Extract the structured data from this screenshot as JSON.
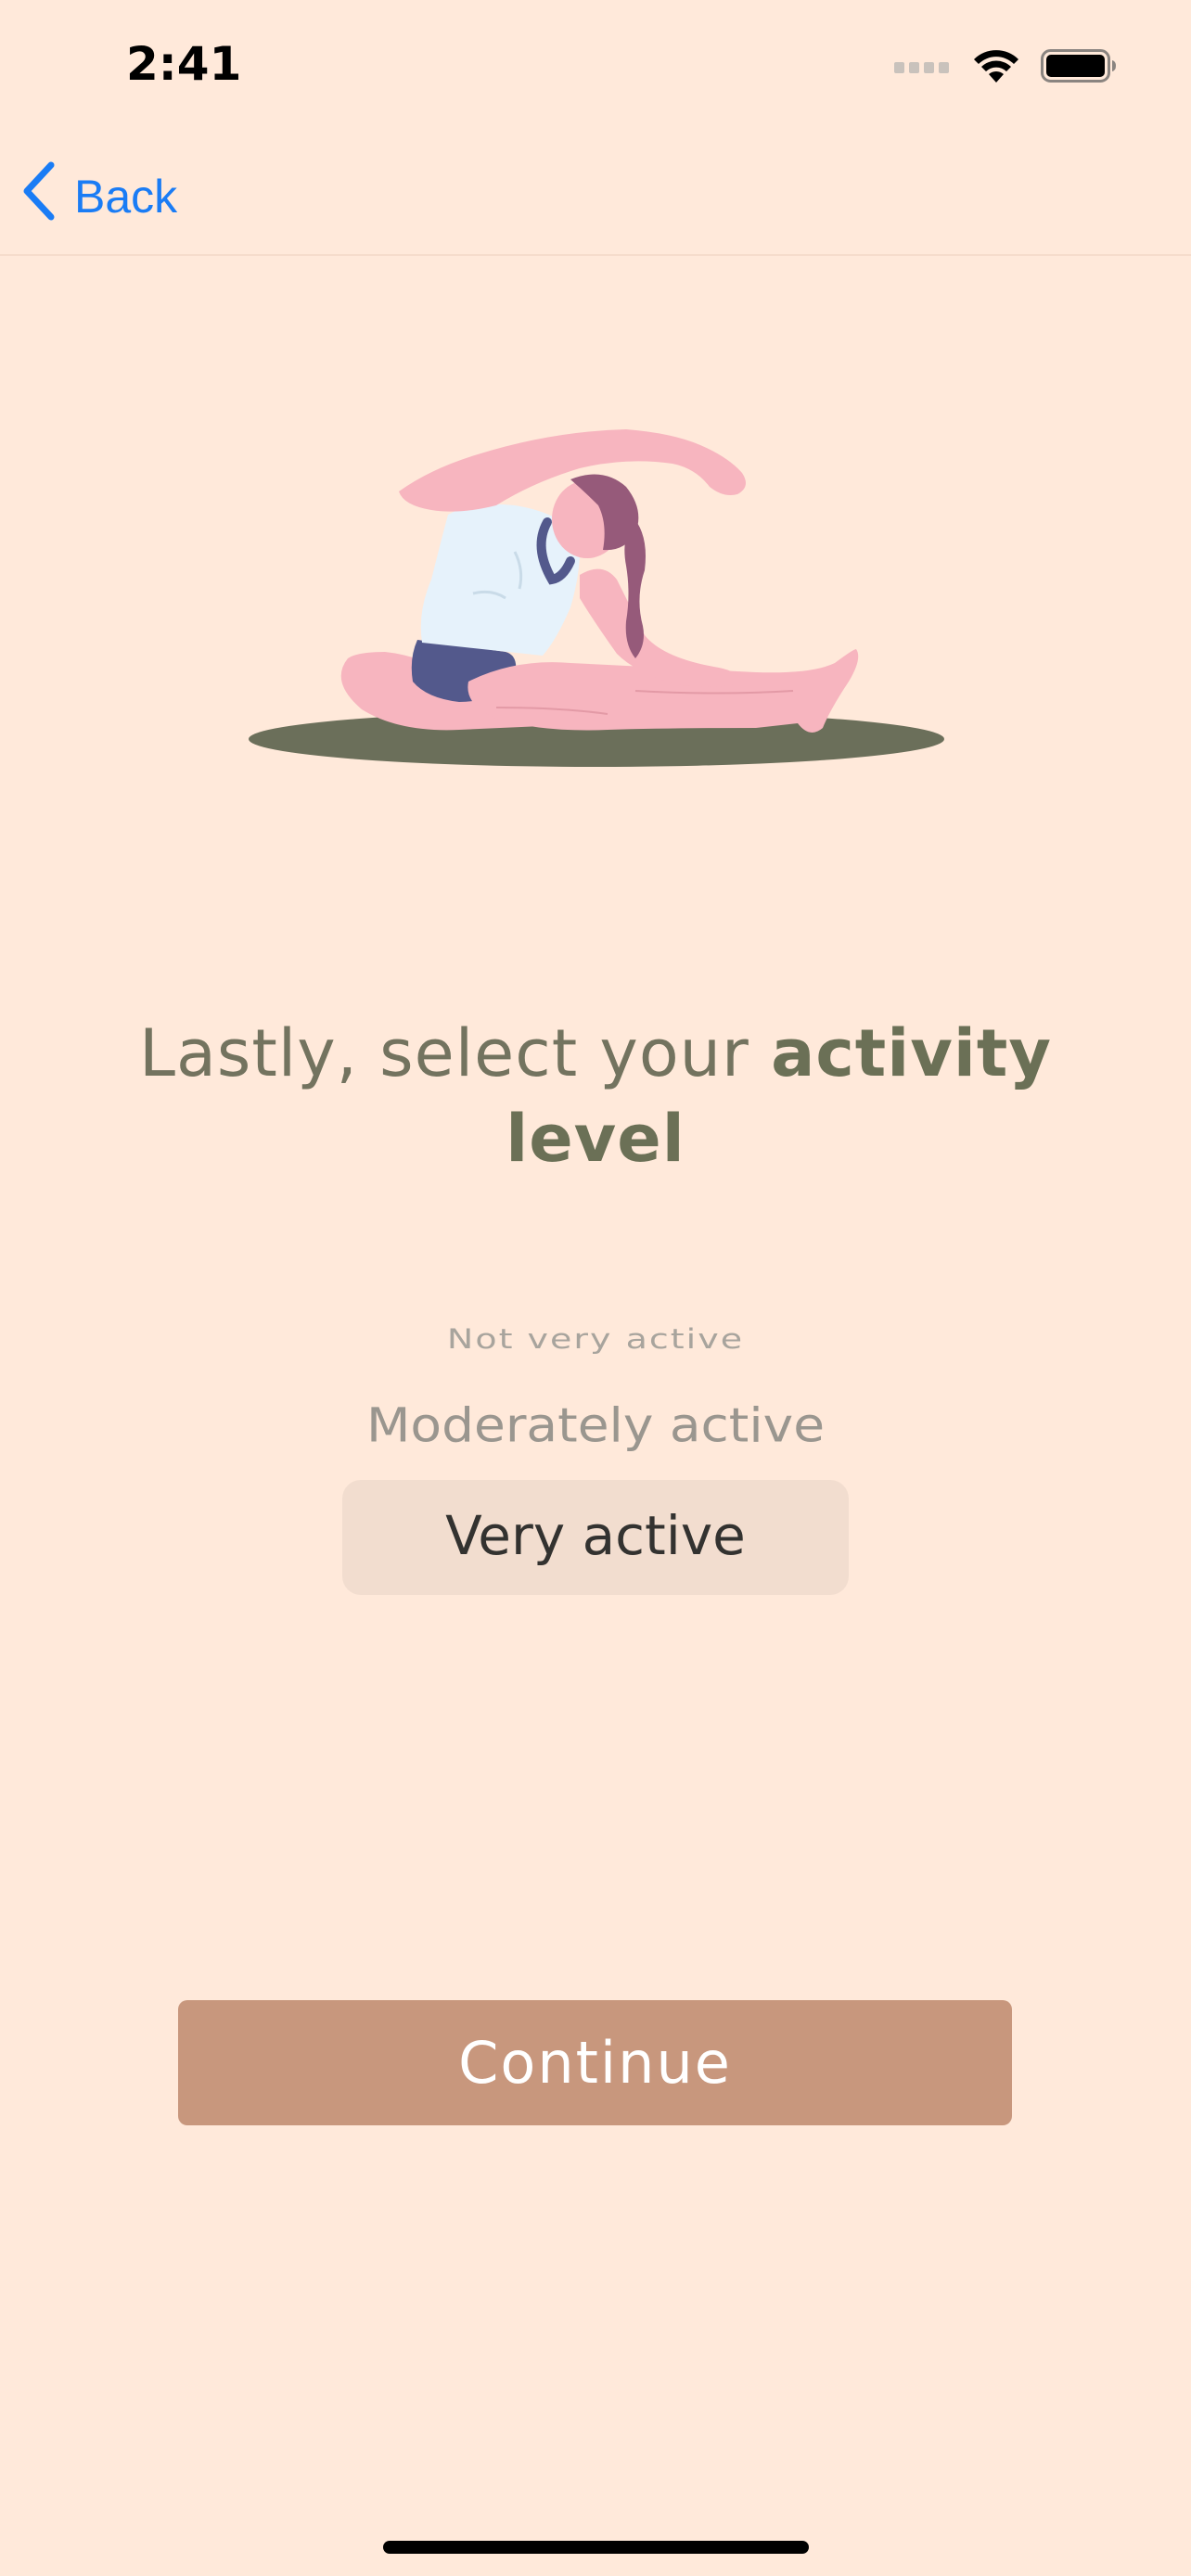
{
  "status_bar": {
    "time": "2:41",
    "icons": [
      "cellular-signal-icon",
      "wifi-icon",
      "battery-icon"
    ]
  },
  "nav": {
    "back_label": "Back",
    "back_icon": "chevron-left-icon"
  },
  "illustration": {
    "icon": "yoga-woman-stretching-illustration"
  },
  "heading": {
    "light": "Lastly, select your ",
    "bold_1": "activity",
    "bold_2": "level"
  },
  "picker": {
    "options": [
      "Not very active",
      "Moderately active",
      "Very active"
    ],
    "selected": "Very active"
  },
  "continue_button": {
    "label": "Continue"
  },
  "colors": {
    "background": "#ffe9da",
    "accent_blue": "#1a7cf5",
    "heading": "#6b7056",
    "button": "#c8977d",
    "picker_highlight": "#f2ddcf"
  }
}
